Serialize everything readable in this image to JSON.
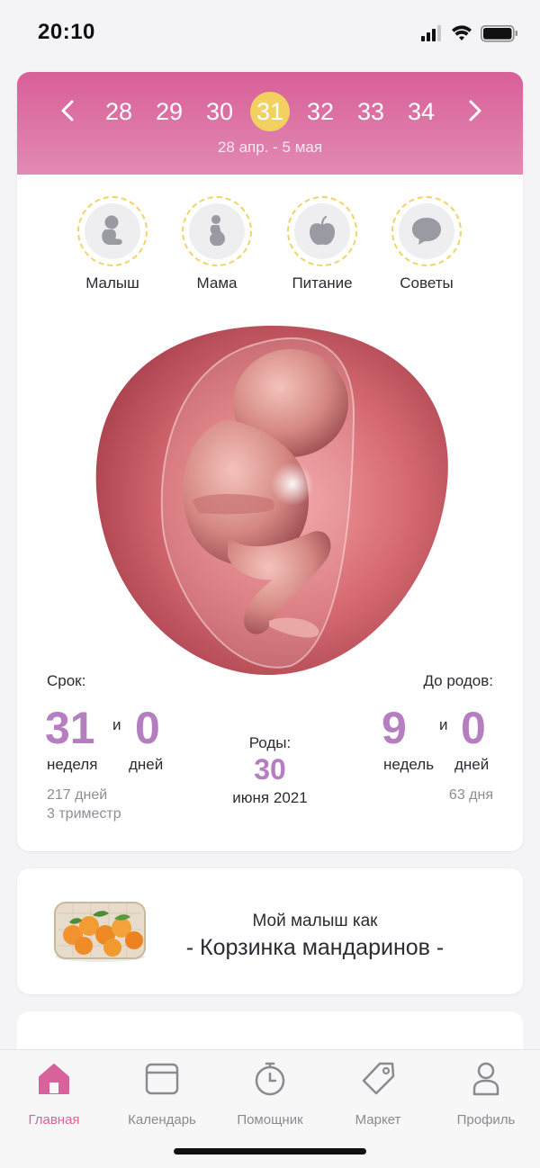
{
  "status_bar": {
    "time": "20:10",
    "icons": [
      "signal-icon",
      "wifi-icon",
      "battery-icon"
    ]
  },
  "week_selector": {
    "weeks": [
      "28",
      "29",
      "30",
      "31",
      "32",
      "33",
      "34"
    ],
    "active_week": "31",
    "date_range": "28 апр. - 5 мая",
    "colors": {
      "header_top": "#d85f98",
      "header_bottom": "#e28ab3",
      "active": "#f3d160"
    }
  },
  "categories": [
    {
      "label": "Малыш",
      "icon": "baby-icon"
    },
    {
      "label": "Мама",
      "icon": "pregnant-mother-icon"
    },
    {
      "label": "Питание",
      "icon": "apple-icon"
    },
    {
      "label": "Советы",
      "icon": "speech-bubble-icon"
    }
  ],
  "fetus_image": "fetus-illustration",
  "term": {
    "title": "Срок:",
    "weeks": "31",
    "and": "и",
    "days": "0",
    "weeks_unit": "неделя",
    "days_unit": "дней",
    "total_days": "217 дней",
    "trimester": "3 триместр"
  },
  "due": {
    "title": "Роды:",
    "day": "30",
    "month_year": "июня 2021"
  },
  "remaining": {
    "title": "До родов:",
    "weeks": "9",
    "and": "и",
    "days": "0",
    "weeks_unit": "недель",
    "days_unit": "дней",
    "total_days": "63 дня"
  },
  "fruit": {
    "line1": "Мой малыш как",
    "line2": "- Корзинка мандаринов -",
    "icon": "tangerine-basket-image"
  },
  "tab_bar": {
    "active_color": "#d8639b",
    "items": [
      {
        "label": "Главная",
        "icon": "home-icon",
        "active": true
      },
      {
        "label": "Календарь",
        "icon": "calendar-icon",
        "active": false
      },
      {
        "label": "Помощник",
        "icon": "stopwatch-icon",
        "active": false
      },
      {
        "label": "Маркет",
        "icon": "price-tag-icon",
        "active": false
      },
      {
        "label": "Профиль",
        "icon": "person-icon",
        "active": false
      }
    ]
  }
}
